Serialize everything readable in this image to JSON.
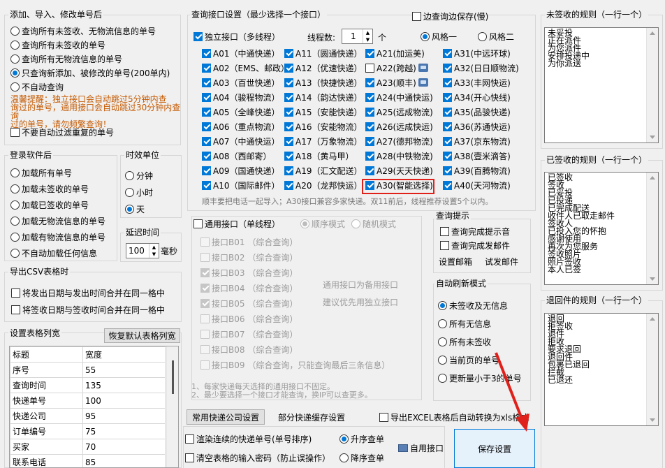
{
  "left": {
    "add_group": {
      "title": "添加、导入、修改单号后",
      "options": [
        "查询所有未签收、无物流信息的单号",
        "查询所有未签收的单号",
        "查询所有无物流信息的单号",
        "只查询新添加、被修改的单号(200单内)",
        "不自动查询"
      ],
      "selected_index": 3,
      "warning": [
        "温馨提醒：独立接口会自动跳过5分钟内查",
        "询过的单号，通用接口会自动跳过30分钟内查询",
        "过的单号，请勿频繁查询！"
      ],
      "no_filter_label": "不要自动过滤重复的单号"
    },
    "login_group": {
      "title": "登录软件后",
      "options": [
        "加载所有单号",
        "加载未签收的单号",
        "加载已签收的单号",
        "加载无物流信息的单号",
        "加载有物流信息的单号",
        "不自动加载任何信息"
      ]
    },
    "time_unit": {
      "title": "时效单位",
      "options": [
        "分钟",
        "小时",
        "天"
      ],
      "selected_index": 2
    },
    "delay": {
      "title": "延迟时间",
      "value": "100",
      "unit": "毫秒"
    },
    "csv": {
      "title": "导出CSV表格时",
      "options": [
        "将发出日期与发出时间合并在同一格中",
        "将签收日期与签收时间合并在同一格中"
      ]
    },
    "cols": {
      "title": "设置表格列宽",
      "reset_button": "恢复默认表格列宽",
      "headers": [
        "标题",
        "宽度"
      ],
      "rows": [
        [
          "序号",
          "55"
        ],
        [
          "查询时间",
          "135"
        ],
        [
          "快递单号",
          "100"
        ],
        [
          "快递公司",
          "95"
        ],
        [
          "订单编号",
          "75"
        ],
        [
          "买家",
          "70"
        ],
        [
          "联系电话",
          "85"
        ]
      ]
    }
  },
  "middle": {
    "query_group": {
      "title": "查询接口设置（最少选择一个接口）",
      "save_while_query_label": "边查询边保存(慢)",
      "independent_label": "独立接口（多线程）",
      "threads_label": "线程数:",
      "threads_value": "1",
      "threads_unit": "个",
      "style1": "风格一",
      "style2": "风格二",
      "carriers": [
        [
          "A01（中通快递）",
          "A11（圆通快递）",
          "A21(加运美)",
          "A31(中远环球)"
        ],
        [
          "A02（EMS、邮政）",
          "A12（优速快递）",
          "A22(跨越)",
          "A32(日日顺物流)"
        ],
        [
          "A03（百世快递）",
          "A13（快捷快递）",
          "A23(顺丰)",
          "A33(丰网快运)"
        ],
        [
          "A04（骏程物流）",
          "A14（韵达快递）",
          "A24(中通快运)",
          "A34(开心快线)"
        ],
        [
          "A05（全峰快递）",
          "A15（安能快递）",
          "A25(远成物流)",
          "A35(品骏快递)"
        ],
        [
          "A06（重点物流）",
          "A16（安能物流）",
          "A26(远成快运)",
          "A36(苏通快运)"
        ],
        [
          "A07（中通快运）",
          "A17（万象物流）",
          "A27(德邦物流)",
          "A37(京东物流)"
        ],
        [
          "A08（西邮寄）",
          "A18（黄马甲）",
          "A28(中铁物流)",
          "A38(壹米滴答)"
        ],
        [
          "A09（国通快递）",
          "A19（汇文配送）",
          "A29(天天快递)",
          "A39(百腾物流)"
        ],
        [
          "A10（国际邮件）",
          "A20（龙邦快运）",
          "A30(智能选择)",
          "A40(天河物流)"
        ]
      ],
      "note": "顺丰要把电话一起导入；A30接口兼容多家快递。双11前后，线程推荐设置5个以内。"
    },
    "general_group": {
      "label": "通用接口（单线程）",
      "mode1": "顺序模式",
      "mode2": "随机模式",
      "items": [
        "接口B01  （综合查询）",
        "接口B02  （综合查询）",
        "接口B03  （综合查询）",
        "接口B04  （综合查询）",
        "接口B05  （综合查询）",
        "接口B06  （综合查询）",
        "接口B07  （综合查询）",
        "接口B08  （综合查询）",
        "接口B09  （综合查询，只能查询最后三条信息）"
      ],
      "hint1": "通用接口为备用接口",
      "hint2": "建议优先用独立接口",
      "footnote1": "1、每家快递每天选择的通用接口不固定。",
      "footnote2": "2、最少要选择一个接口才能查询，换IP可以查更多。"
    },
    "query_tip": {
      "title": "查询提示",
      "opt1": "查询完成提示音",
      "opt2": "查询完成发邮件",
      "btn_mail": "设置邮箱",
      "btn_test": "试发邮件"
    },
    "auto_refresh": {
      "title": "自动刷新模式",
      "options": [
        "未签收及无信息",
        "所有无信息",
        "所有未签收",
        "当前页的单号",
        "更新量小于3的单号"
      ],
      "selected_index": 0
    },
    "bottom": {
      "common_button": "常用快递公司设置",
      "partial_cache": "部分快递缓存设置",
      "export_excel": "导出EXCEL表格后自动转换为xls格式",
      "render_label": "渲染连续的快递单号(单号排序)",
      "clear_label": "清空表格的输入密码（防止误操作）",
      "asc": "升序查单",
      "desc": "降序查单",
      "self_interface": "自用接口",
      "save_button": "保存设置"
    }
  },
  "right": {
    "unsigned": {
      "title": "未签收的规则（一行一个）",
      "lines": [
        "未妥投",
        "正在派件",
        "为您派件",
        "安排投递中",
        "为你派送"
      ]
    },
    "signed": {
      "title": "已签收的规则（一行一个）",
      "lines": [
        "已签收",
        "签收",
        "已妥投",
        "已投递",
        "已完成配送",
        "收件人已取走邮件",
        "签收人",
        "已投入您的怀抱",
        "感谢使用",
        "再次为您服务",
        "签收照片",
        "照片签收",
        "本人已签"
      ]
    },
    "returned": {
      "title": "退回件的规则（一行一个）",
      "lines": [
        "退回",
        "拒签收",
        "退件",
        "拒收",
        "要求退回",
        "退回件",
        "包裹已退回",
        "拦截",
        "已退还"
      ]
    }
  }
}
